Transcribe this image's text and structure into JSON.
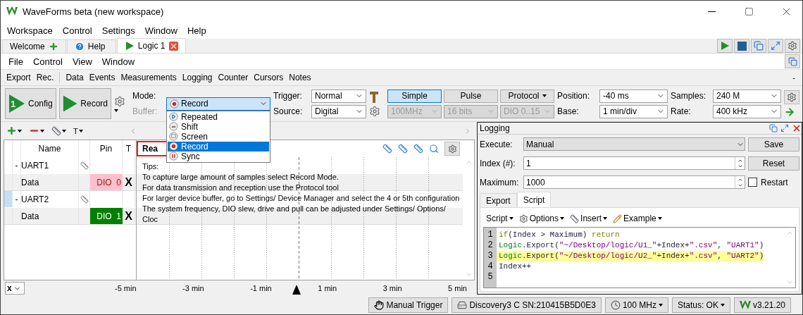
{
  "window": {
    "title": "WaveForms beta (new workspace)"
  },
  "menu": [
    "Workspace",
    "Control",
    "Settings",
    "Window",
    "Help"
  ],
  "tabs": [
    {
      "label": "Welcome",
      "kind": "plus",
      "selected": false,
      "closable": false
    },
    {
      "label": "Help",
      "kind": "help",
      "selected": false,
      "closable": false
    },
    {
      "label": "Logic 1",
      "kind": "play",
      "selected": true,
      "closable": true
    }
  ],
  "instrument_menu": [
    "File",
    "Control",
    "View",
    "Window"
  ],
  "toolbar": {
    "groups": [
      [
        "Export",
        "Rec."
      ],
      [
        "Data",
        "Events",
        "Measurements",
        "Logging",
        "Counter",
        "Cursors",
        "Notes"
      ]
    ],
    "collapse": "-"
  },
  "actions": [
    {
      "label": "Config",
      "badge": "1"
    },
    {
      "label": "Record"
    }
  ],
  "mode": {
    "label": "Mode:",
    "value": "Record",
    "expanded": true,
    "options": [
      {
        "label": "Repeated",
        "kind": "repeat",
        "selected": false
      },
      {
        "label": "Shift",
        "kind": "shift",
        "selected": false
      },
      {
        "label": "Screen",
        "kind": "screen",
        "selected": false
      },
      {
        "label": "Record",
        "kind": "record",
        "selected": true
      },
      {
        "label": "Sync",
        "kind": "sync",
        "selected": false
      }
    ]
  },
  "buffer": {
    "label": "Buffer:",
    "disabled": true
  },
  "trigger": {
    "label": "Trigger:",
    "value": "Normal"
  },
  "source": {
    "label": "Source:",
    "value": "Digital"
  },
  "trigger_types": [
    {
      "label": "Simple",
      "selected": true,
      "menu": false
    },
    {
      "label": "Pulse",
      "selected": false,
      "menu": false
    },
    {
      "label": "Protocol",
      "selected": false,
      "menu": true
    }
  ],
  "source_options": [
    {
      "value": "100MHz",
      "disabled": true
    },
    {
      "value": "16 bits",
      "disabled": true
    },
    {
      "value": "DIO 0..15",
      "disabled": true
    }
  ],
  "position": {
    "label": "Position:",
    "value": "-40 ms"
  },
  "base": {
    "label": "Base:",
    "value": "1 min/div"
  },
  "samples": {
    "label": "Samples:",
    "value": "240 M"
  },
  "rate": {
    "label": "Rate:",
    "value": "400 kHz"
  },
  "channel_tools": {
    "text_label": "T"
  },
  "channels": {
    "columns": [
      "Name",
      "Pin",
      "T",
      "Rea"
    ],
    "groups": [
      {
        "name": "UART1",
        "toggle": "-",
        "selected": false,
        "children": [
          {
            "name": "Data",
            "pin": "DIO  0",
            "color": "#ffc0cb",
            "trigger": "X"
          }
        ]
      },
      {
        "name": "UART2",
        "toggle": "-",
        "selected": true,
        "children": [
          {
            "name": "Data",
            "pin": "DIO  1",
            "color": "#008000",
            "trigger": "X"
          }
        ]
      }
    ]
  },
  "plot": {
    "tips": [
      "Tips:",
      "To capture large amount of samples select Record Mode.",
      "For data transmission and reception use the Protocol tool",
      "For larger device buffer, go to Settings/ Device Manager and select the 4 or 5th configuration",
      "The system frequency, DIO slew, drive and pull can be adjusted under Settings/ Options/ Cloc"
    ],
    "axis_button": "x",
    "ticks": [
      "-5 min",
      "-3 min",
      "-1 min",
      "1 min",
      "3 min",
      "5 min"
    ]
  },
  "logging": {
    "title": "Logging",
    "execute": {
      "label": "Execute:",
      "value": "Manual"
    },
    "index": {
      "label": "Index (#):",
      "value": "1"
    },
    "maximum": {
      "label": "Maximum:",
      "value": "1000"
    },
    "buttons": [
      "Save",
      "Reset"
    ],
    "restart": {
      "label": "Restart",
      "checked": false
    },
    "tabs": [
      {
        "label": "Export",
        "selected": false
      },
      {
        "label": "Script",
        "selected": true
      }
    ],
    "script_menu": [
      {
        "label": "Script",
        "kind": "none"
      },
      {
        "label": "Options",
        "kind": "gear"
      },
      {
        "label": "Insert",
        "kind": "ruler"
      },
      {
        "label": "Example",
        "kind": "pencil"
      }
    ],
    "code": [
      {
        "number": "1",
        "highlighted": false,
        "tokens": [
          {
            "kind": "keyword",
            "text": "if"
          },
          {
            "kind": "plain",
            "text": "(Index > Maximum) "
          },
          {
            "kind": "keyword",
            "text": "return"
          }
        ]
      },
      {
        "number": "2",
        "highlighted": false,
        "tokens": [
          {
            "kind": "object",
            "text": "Logic"
          },
          {
            "kind": "plain",
            "text": ".Export("
          },
          {
            "kind": "string",
            "text": "\"~/Desktop/logic/U1_\""
          },
          {
            "kind": "plain",
            "text": "+Index+"
          },
          {
            "kind": "string",
            "text": "\".csv\""
          },
          {
            "kind": "plain",
            "text": ", "
          },
          {
            "kind": "string",
            "text": "\"UART1\""
          },
          {
            "kind": "plain",
            "text": ")"
          }
        ]
      },
      {
        "number": "3",
        "highlighted": true,
        "tokens": [
          {
            "kind": "object",
            "text": "Logic"
          },
          {
            "kind": "plain",
            "text": ".Export("
          },
          {
            "kind": "string",
            "text": "\"~/Desktop/logic/U2_\""
          },
          {
            "kind": "plain",
            "text": "+Index+"
          },
          {
            "kind": "string",
            "text": "\".csv\""
          },
          {
            "kind": "plain",
            "text": ", "
          },
          {
            "kind": "string",
            "text": "\"UART2\""
          },
          {
            "kind": "plain",
            "text": ")"
          }
        ]
      },
      {
        "number": "4",
        "highlighted": false,
        "tokens": [
          {
            "kind": "plain",
            "text": "Index++"
          }
        ]
      },
      {
        "number": "5",
        "highlighted": false
      }
    ]
  },
  "status_bar": [
    {
      "label": "Manual Trigger",
      "kind": "hand",
      "menu": false
    },
    {
      "label": "Discovery3 C SN:210415B5D0E3",
      "kind": "device",
      "menu": false
    },
    {
      "label": "100 MHz",
      "kind": "clock",
      "menu": true
    },
    {
      "label": "Status: OK",
      "kind": "none",
      "menu": true
    },
    {
      "label": "v3.21.20",
      "kind": "logo",
      "menu": false
    }
  ]
}
